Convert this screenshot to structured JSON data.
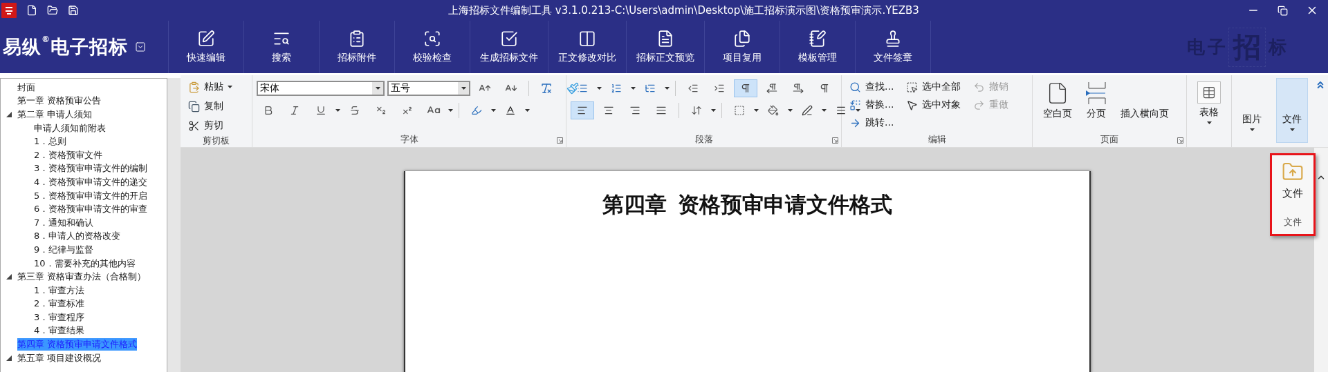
{
  "window": {
    "title": "上海招标文件编制工具 v3.1.0.213-C:\\Users\\admin\\Desktop\\施工招标演示图\\资格预审演示.YEZB3"
  },
  "brand": {
    "name": "易纵$^{®}$电子招标"
  },
  "toolbar": [
    {
      "label": "快速编辑",
      "kind": "edit"
    },
    {
      "label": "搜索",
      "kind": "search"
    },
    {
      "label": "招标附件",
      "kind": "attach"
    },
    {
      "label": "校验检查",
      "kind": "check"
    },
    {
      "label": "生成招标文件",
      "kind": "generate"
    },
    {
      "label": "正文修改对比",
      "kind": "compare"
    },
    {
      "label": "招标正文预览",
      "kind": "preview"
    },
    {
      "label": "项目复用",
      "kind": "reuse"
    },
    {
      "label": "模板管理",
      "kind": "template"
    },
    {
      "label": "文件签章",
      "kind": "sign"
    }
  ],
  "banner_art": [
    {
      "char": "电",
      "big": false
    },
    {
      "char": "子",
      "big": false
    },
    {
      "char": "招",
      "big": true
    },
    {
      "char": "标",
      "big": false
    }
  ],
  "sidebar": {
    "items": [
      {
        "label": "封面",
        "selected": false
      },
      {
        "label": "第一章 资格预审公告",
        "selected": false
      },
      {
        "label": "第二章 申请人须知",
        "selected": false,
        "expanded": true,
        "children": [
          {
            "label": "申请人须知前附表",
            "selected": false
          },
          {
            "label": "1．总则",
            "selected": false
          },
          {
            "label": "2．资格预审文件",
            "selected": false
          },
          {
            "label": "3．资格预审申请文件的编制",
            "selected": false
          },
          {
            "label": "4．资格预审申请文件的递交",
            "selected": false
          },
          {
            "label": "5．资格预审申请文件的开启",
            "selected": false
          },
          {
            "label": "6．资格预审申请文件的审查",
            "selected": false
          },
          {
            "label": "7．通知和确认",
            "selected": false
          },
          {
            "label": "8．申请人的资格改变",
            "selected": false
          },
          {
            "label": "9．纪律与监督",
            "selected": false
          },
          {
            "label": "10．需要补充的其他内容",
            "selected": false
          }
        ]
      },
      {
        "label": "第三章 资格审查办法（合格制）",
        "selected": false,
        "expanded": true,
        "children": [
          {
            "label": "1．审查方法",
            "selected": false
          },
          {
            "label": "2．审查标准",
            "selected": false
          },
          {
            "label": "3．审查程序",
            "selected": false
          },
          {
            "label": "4．审查结果",
            "selected": false
          }
        ]
      },
      {
        "label": "第四章 资格预审申请文件格式",
        "selected": true
      },
      {
        "label": "第五章 项目建设概况",
        "selected": false,
        "expanded": true
      }
    ]
  },
  "ribbon": {
    "clipboard": {
      "label": "剪切板",
      "items": [
        {
          "label": "粘贴",
          "kind": "paste"
        },
        {
          "label": "复制",
          "kind": "copy"
        },
        {
          "label": "剪切",
          "kind": "cut"
        }
      ]
    },
    "font": {
      "label": "字体",
      "family": "宋体",
      "size": "五号"
    },
    "paragraph": {
      "label": "段落",
      "marks": [
        {
          "selected": true
        },
        {
          "selected": false
        },
        {
          "selected": false
        },
        {
          "selected": false
        }
      ],
      "alignment": [
        {
          "selected": true
        },
        {
          "selected": false
        },
        {
          "selected": false
        },
        {
          "selected": false
        }
      ]
    },
    "editing": {
      "label": "编辑",
      "items": [
        {
          "label": "查找...",
          "kind": "find",
          "disabled": false
        },
        {
          "label": "替换...",
          "kind": "replace",
          "disabled": false
        },
        {
          "label": "跳转...",
          "kind": "goto",
          "disabled": false
        },
        {
          "label": "选中全部",
          "kind": "select-all",
          "disabled": false
        },
        {
          "label": "选中对象",
          "kind": "select-object",
          "disabled": false
        },
        {
          "label": "撤销",
          "kind": "undo",
          "disabled": true
        },
        {
          "label": "重做",
          "kind": "redo",
          "disabled": true
        }
      ]
    },
    "page": {
      "label": "页面",
      "items": [
        {
          "label": "空白页",
          "kind": "blank"
        },
        {
          "label": "分页",
          "kind": "break"
        },
        {
          "label": "插入横向页",
          "kind": "landscape"
        }
      ]
    },
    "inserts": [
      {
        "label": "表格",
        "kind": "table",
        "selected": false
      },
      {
        "label": "图片",
        "kind": "picture",
        "selected": false
      },
      {
        "label": "文件",
        "kind": "file",
        "selected": true
      }
    ]
  },
  "document": {
    "heading": "第四章  资格预审申请文件格式"
  },
  "popup": {
    "button": "文件",
    "group": "文件"
  }
}
